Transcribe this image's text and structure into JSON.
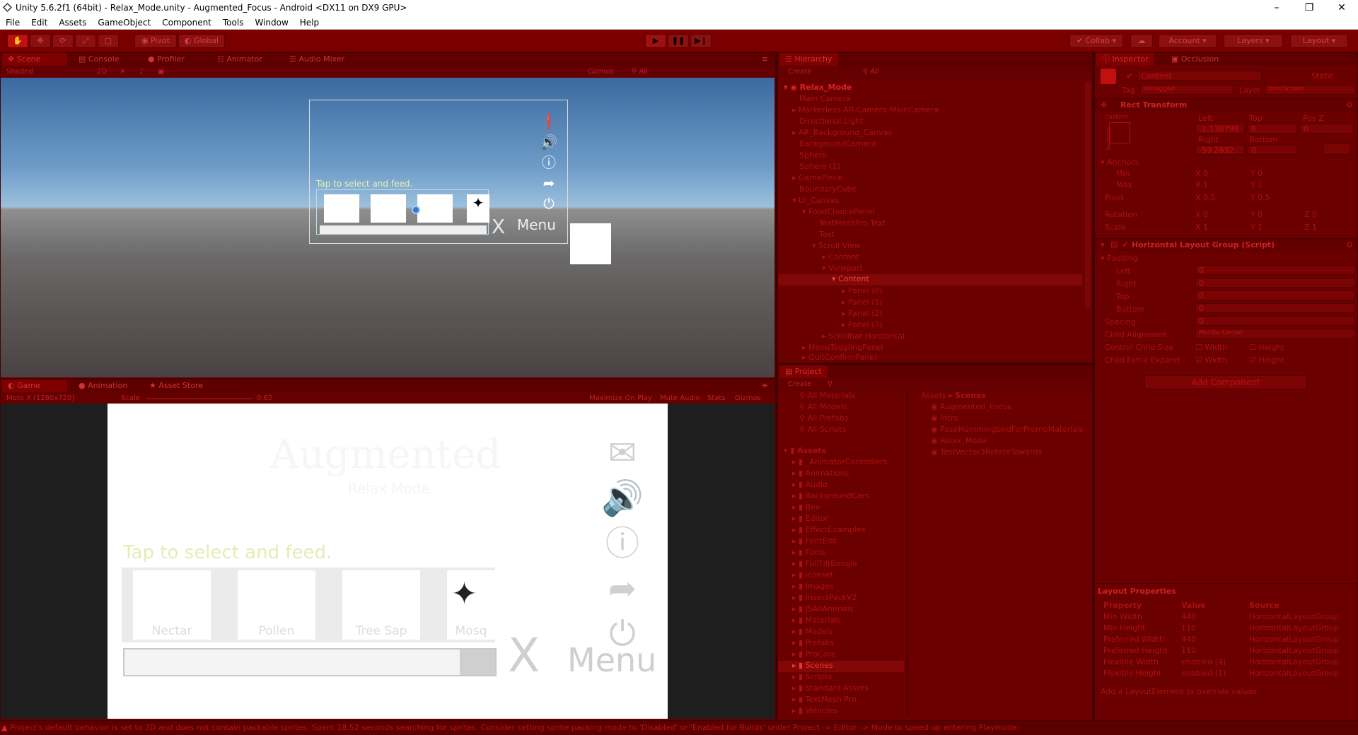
{
  "window": {
    "title": "Unity 5.6.2f1 (64bit) - Relax_Mode.unity - Augmented_Focus - Android <DX11 on DX9 GPU>"
  },
  "menu": [
    "File",
    "Edit",
    "Assets",
    "GameObject",
    "Component",
    "Tools",
    "Window",
    "Help"
  ],
  "toolbar": {
    "pivot": "Pivot",
    "global": "Global",
    "collab": "Collab",
    "account": "Account",
    "layers": "Layers",
    "layout": "Layout"
  },
  "scene_tabs": [
    "Scene",
    "Console",
    "Profiler",
    "Animator",
    "Audio Mixer"
  ],
  "scene_bar": {
    "shading": "Shaded",
    "mode2d": "2D",
    "gizmos": "Gizmos",
    "search": "All"
  },
  "scene_ui": {
    "hint": "Tap to select and feed.",
    "menu": "Menu",
    "x": "X"
  },
  "game_tabs": [
    "Game",
    "Animation",
    "Asset Store"
  ],
  "game_bar": {
    "res": "Moto X (1280x720)",
    "scale_label": "Scale",
    "scale": "0.62",
    "maximize": "Maximize On Play",
    "mute": "Mute Audio",
    "stats": "Stats",
    "gizmos": "Gizmos"
  },
  "game_ui": {
    "logo": "Augmented",
    "sub": "Relax Mode",
    "hint": "Tap to select and feed.",
    "items": [
      "Nectar",
      "Pollen",
      "Tree Sap",
      "Mosq"
    ],
    "x": "X",
    "menu": "Menu"
  },
  "hierarchy": {
    "tab": "Hierarchy",
    "create": "Create",
    "search": "All",
    "rows": [
      "Relax_Mode",
      "Main Camera",
      "Markerless-AR-Camera-MainCamera",
      "Directional Light",
      "AR_Background_Canvas",
      "BackgroundCamera",
      "Sphere",
      "Sphere (1)",
      "GamePiece",
      "BoundaryCube",
      "UI_Canvas",
      "FoodChoicePanel",
      "TextMeshPro Text",
      "Text",
      "Scroll View",
      "Content",
      "Viewport",
      "Content",
      "Panel (0)",
      "Panel (1)",
      "Panel (2)",
      "Panel (3)",
      "Scrollbar Horizontal",
      "MenuTogglingPanel",
      "QuitConfirmPanel"
    ]
  },
  "project": {
    "tab": "Project",
    "create": "Create",
    "favorites": [
      "All Materials",
      "All Models",
      "All Prefabs",
      "All Scripts"
    ],
    "assets_root": "Assets",
    "folders": [
      "_AnimatorControllers",
      "Animations",
      "Audio",
      "BackgroundCars",
      "Bee",
      "Editor",
      "EffectExamples",
      "FontEdit",
      "Fonts",
      "FullTiltBoogie",
      "iconset",
      "Images",
      "InsectPackV2",
      "JSAllAnimals",
      "Materials",
      "Models",
      "Prefabs",
      "ProCore",
      "Scenes",
      "Scripts",
      "Standard Assets",
      "TextMesh Pro",
      "Vehicles"
    ],
    "breadcrumb": [
      "Assets",
      "Scenes"
    ],
    "files": [
      "Augmented_Focus",
      "Intro",
      "PoseHummingbirdForPromoMaterials",
      "Relax_Mode",
      "TestVector3RotateTowards"
    ]
  },
  "inspector": {
    "tabs": [
      "Inspector",
      "Occlusion"
    ],
    "object_name": "Content",
    "static": "Static",
    "tag_label": "Tag",
    "tag": "Untagged",
    "layer_label": "Layer",
    "layer": "IntroScreen",
    "rect": {
      "title": "Rect Transform",
      "custom": "custom",
      "bottom": "bottom",
      "heads": [
        "Left",
        "Top",
        "Pos Z"
      ],
      "vals": [
        "-1.130798",
        "0",
        "0"
      ],
      "heads2": [
        "Right",
        "Bottom"
      ],
      "vals2": [
        "-59.2692",
        "0"
      ],
      "anchors": "Anchors",
      "min": "Min",
      "max": "Max",
      "min_x": "0",
      "min_y": "0",
      "max_x": "1",
      "max_y": "1",
      "pivot": "Pivot",
      "pivot_x": "0.5",
      "pivot_y": "0.5",
      "rotation": "Rotation",
      "rot": [
        "0",
        "0",
        "0"
      ],
      "scale": "Scale",
      "scl": [
        "1",
        "1",
        "1"
      ]
    },
    "hlg": {
      "title": "Horizontal Layout Group (Script)",
      "padding": "Padding",
      "rows": [
        [
          "Left",
          "0"
        ],
        [
          "Right",
          "0"
        ],
        [
          "Top",
          "0"
        ],
        [
          "Bottom",
          "0"
        ]
      ],
      "spacing": "Spacing",
      "spacing_v": "0",
      "align": "Child Alignment",
      "align_v": "Middle Center",
      "ccs": "Control Child Size",
      "cfe": "Child Force Expand",
      "width": "Width",
      "height": "Height"
    },
    "add_component": "Add Component",
    "layout_props": {
      "title": "Layout Properties",
      "heads": [
        "Property",
        "Value",
        "Source"
      ],
      "rows": [
        [
          "Min Width",
          "440",
          "HorizontalLayoutGroup"
        ],
        [
          "Min Height",
          "110",
          "HorizontalLayoutGroup"
        ],
        [
          "Preferred Width",
          "440",
          "HorizontalLayoutGroup"
        ],
        [
          "Preferred Height",
          "110",
          "HorizontalLayoutGroup"
        ],
        [
          "Flexible Width",
          "enabled (4)",
          "HorizontalLayoutGroup"
        ],
        [
          "Flexible Height",
          "enabled (1)",
          "HorizontalLayoutGroup"
        ]
      ],
      "note": "Add a LayoutElement to override values."
    }
  },
  "status": "Project's default behavior is set to 3D and does not contain packable sprites. Spent 18.52 seconds searching for sprites. Consider setting sprite packing mode to 'Disabled' or 'Enabled for Builds' under Project -> Editor -> Mode to speed up entering Playmode."
}
